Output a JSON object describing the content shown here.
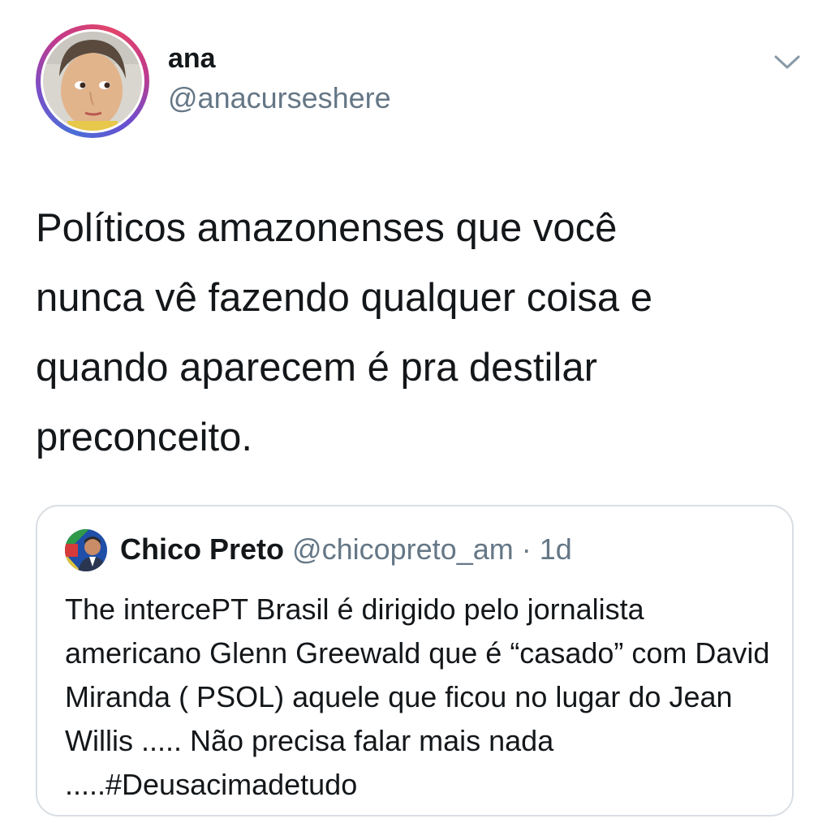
{
  "tweet": {
    "author": {
      "name": "ana",
      "handle": "@anacurseshere"
    },
    "text": "Políticos amazonenses que você\nnunca vê fazendo qualquer coisa e\nquando aparecem é pra destilar\npreconceito."
  },
  "quoted_tweet": {
    "author": {
      "name": "Chico Preto",
      "handle": "@chicopreto_am"
    },
    "separator": "·",
    "time": "1d",
    "text": "The intercePT Brasil é dirigido pelo jornalista americano Glenn Greewald que é “casado” com David Miranda ( PSOL) aquele que ficou no lugar do Jean Willis ..... Não precisa falar mais nada .....#Deusacimadetudo"
  },
  "icons": {
    "menu": "chevron-down-icon"
  },
  "colors": {
    "text": "#14171a",
    "secondary": "#657786",
    "border": "#d9dee3"
  }
}
